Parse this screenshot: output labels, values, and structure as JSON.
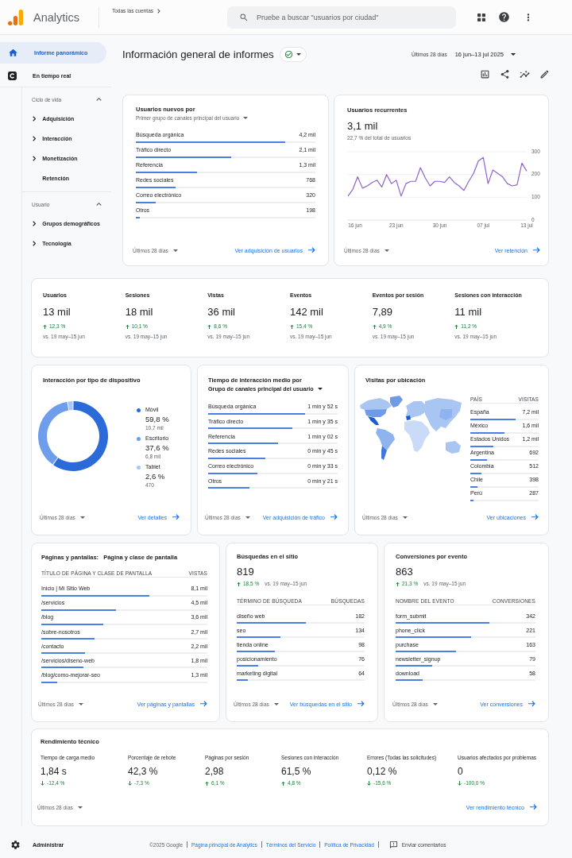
{
  "header": {
    "product": "Analytics",
    "breadcrumb": "Todas las cuentas",
    "search": {
      "placeholder": "Pruebe a buscar \"usuarios por ciudad\""
    }
  },
  "nav": {
    "items": [
      {
        "label": "Informe panorámico",
        "selected": true
      },
      {
        "label": "En tiempo real",
        "selected": false
      }
    ],
    "sections": [
      {
        "title": "Ciclo de vida",
        "expanded": true,
        "items": [
          {
            "label": "Adquisición",
            "kind": "group"
          },
          {
            "label": "Interacción",
            "kind": "group"
          },
          {
            "label": "Monetización",
            "kind": "group"
          },
          {
            "label": "Retención",
            "kind": "page"
          }
        ]
      },
      {
        "title": "Usuario",
        "expanded": true,
        "items": [
          {
            "label": "Grupos demográficos",
            "kind": "group"
          },
          {
            "label": "Tecnología",
            "kind": "group"
          }
        ]
      }
    ]
  },
  "report_header": {
    "title": "Información general de informes",
    "date_label": "Últimos 28 días",
    "date_range": "16 jun–13 jul 2025"
  },
  "new_users": {
    "title": "Usuarios nuevos por",
    "dimension": "Primer grupo de canales principal del usuario",
    "rows": [
      {
        "label": "Búsqueda orgánica",
        "value": "4,2 mil",
        "level": 0.83
      },
      {
        "label": "Tráfico directo",
        "value": "2,1 mil",
        "level": 0.53
      },
      {
        "label": "Referencia",
        "value": "1,3 mil",
        "level": 0.34
      },
      {
        "label": "Redes sociales",
        "value": "768",
        "level": 0.22
      },
      {
        "label": "Correo electrónico",
        "value": "320",
        "level": 0.11
      },
      {
        "label": "Otros",
        "value": "198",
        "level": 0.02
      }
    ],
    "period": "Últimos 28 días",
    "link": "Ver adquisición de usuarios"
  },
  "returning_users": {
    "title": "Usuarios recurrentes",
    "value": "3,1 mil",
    "note": "22,7 % del total de usuarios",
    "chart_data": {
      "type": "line",
      "categories": [
        null,
        "16 jun",
        null,
        null,
        null,
        null,
        null,
        null,
        null,
        null,
        "23 jun",
        null,
        null,
        null,
        null,
        null,
        null,
        null,
        null,
        "30 jun",
        null,
        null,
        null,
        null,
        null,
        null,
        null,
        null,
        "07 jul",
        null,
        null,
        null,
        null,
        null,
        null,
        null,
        null,
        "13 jul"
      ],
      "series": [
        {
          "color": "#8f63c9",
          "values": [
            105,
            135,
            190,
            140,
            150,
            165,
            175,
            145,
            200,
            160,
            175,
            105,
            160,
            170,
            170,
            230,
            185,
            150,
            170,
            170,
            165,
            190,
            165,
            150,
            130,
            170,
            205,
            260,
            275,
            160,
            220,
            205,
            190,
            160,
            150,
            155,
            250,
            215
          ]
        }
      ],
      "ylim": [
        0,
        300
      ],
      "yticks": [
        0,
        100,
        200,
        300
      ]
    },
    "period": "Últimos 28 días",
    "link": "Ver retención"
  },
  "summary": [
    {
      "label": "Usuarios",
      "value": "13 mil",
      "rising": true,
      "change": "12,3 %",
      "comparison": "vs. 19 may–15 jun"
    },
    {
      "label": "Sesiones",
      "value": "18 mil",
      "rising": true,
      "change": "10,1 %",
      "comparison": "vs. 19 may–15 jun"
    },
    {
      "label": "Vistas",
      "value": "36 mil",
      "rising": true,
      "change": "8,6 %",
      "comparison": "vs. 19 may–15 jun"
    },
    {
      "label": "Eventos",
      "value": "142 mil",
      "rising": true,
      "change": "15,4 %",
      "comparison": "vs. 19 may–15 jun"
    },
    {
      "label": "Eventos por sesión",
      "value": "7,89",
      "rising": true,
      "change": "4,9 %",
      "comparison": "vs. 19 may–15 jun"
    },
    {
      "label": "Sesiones con interacción",
      "value": "11 mil",
      "rising": true,
      "change": "11,2 %",
      "comparison": "vs. 19 may–15 jun"
    }
  ],
  "devices": {
    "title": "Interacción por tipo de dispositivo",
    "chart_data": {
      "type": "donut",
      "values": [
        59.8,
        37.6,
        2.6
      ]
    },
    "legend": [
      {
        "label": "Móvil",
        "share": "59,8 %",
        "count": "10,7 mil",
        "color": "#2b6bd9"
      },
      {
        "label": "Escritorio",
        "share": "37,6 %",
        "count": "6,8 mil",
        "color": "#6d9deb"
      },
      {
        "label": "Tablet",
        "share": "2,6 %",
        "count": "470",
        "color": "#a9c6f4"
      }
    ],
    "period": "Últimos 28 días",
    "link": "Ver detalles"
  },
  "engagement_time": {
    "title": "Tiempo de interacción medio por",
    "dimension": "Grupo de canales principal del usuario",
    "rows": [
      {
        "label": "Búsqueda orgánica",
        "value": "1 min y 52 s",
        "level": 0.75
      },
      {
        "label": "Tráfico directo",
        "value": "1 min y 35 s",
        "level": 0.65
      },
      {
        "label": "Referencia",
        "value": "1 min y 02 s",
        "level": 0.54
      },
      {
        "label": "Redes sociales",
        "value": "0 min y 45 s",
        "level": 0.44
      },
      {
        "label": "Correo electrónico",
        "value": "0 min y 33 s",
        "level": 0.38
      },
      {
        "label": "Otros",
        "value": "0 min y 21 s",
        "level": 0.32
      }
    ],
    "period": "Últimos 28 días",
    "link": "Ver adquisición de tráfico"
  },
  "locations": {
    "title": "Visitas por ubicación",
    "columns": [
      "PAÍS",
      "VISITAS"
    ],
    "rows": [
      {
        "label": "España",
        "value": "7,2 mil",
        "level": 0.66
      },
      {
        "label": "México",
        "value": "1,6 mil",
        "level": 0.5
      },
      {
        "label": "Estados Unidos",
        "value": "1,2 mil",
        "level": 0.34
      },
      {
        "label": "Argentina",
        "value": "692",
        "level": 0.24
      },
      {
        "label": "Colombia",
        "value": "512",
        "level": 0.16
      },
      {
        "label": "Chile",
        "value": "398",
        "level": 0.1
      },
      {
        "label": "Perú",
        "value": "287",
        "level": 0.05
      }
    ],
    "period": "Últimos 28 días",
    "link": "Ver ubicaciones"
  },
  "pages": {
    "title": "Páginas y pantallas:",
    "dimension": "Página y clase de pantalla",
    "columns": [
      "TÍTULO DE PÁGINA Y CLASE DE PANTALLA",
      "VISTAS"
    ],
    "rows": [
      {
        "label": "Inicio | Mi Sitio Web",
        "value": "8,1 mil",
        "level": 0.65
      },
      {
        "label": "/servicios",
        "value": "4,5 mil",
        "level": 0.45
      },
      {
        "label": "/blog",
        "value": "3,6 mil",
        "level": 0.375
      },
      {
        "label": "/sobre-nosotros",
        "value": "2,7 mil",
        "level": 0.32
      },
      {
        "label": "/contacto",
        "value": "2,2 mil",
        "level": 0.265
      },
      {
        "label": "/servicios/diseno-web",
        "value": "1,8 mil",
        "level": 0.255
      },
      {
        "label": "/blog/como-mejorar-seo",
        "value": "1,3 mil",
        "level": 0.095
      }
    ],
    "period": "Últimos 28 días",
    "link": "Ver páginas y pantallas"
  },
  "site_search": {
    "title": "Búsquedas en el sitio",
    "value": "819",
    "rising": true,
    "change": "18,5 %",
    "comparison": "vs. 19 may–15 jun",
    "columns": [
      "TÉRMINO DE BÚSQUEDA",
      "BÚSQUEDAS"
    ],
    "rows": [
      {
        "label": "diseño web",
        "value": "182",
        "level": 0.54
      },
      {
        "label": "seo",
        "value": "134",
        "level": 0.34
      },
      {
        "label": "tienda online",
        "value": "98",
        "level": 0.3
      },
      {
        "label": "posicionamiento",
        "value": "76",
        "level": 0.17
      },
      {
        "label": "marketing digital",
        "value": "64",
        "level": 0.09
      }
    ],
    "period": "Últimos 28 días",
    "link": "Ver búsquedas en el sitio"
  },
  "conversions": {
    "title": "Conversiones por evento",
    "value": "863",
    "rising": true,
    "change": "21,3 %",
    "comparison": "vs. 19 may–15 jun",
    "columns": [
      "NOMBRE DEL EVENTO",
      "CONVERSIONES"
    ],
    "rows": [
      {
        "label": "form_submit",
        "value": "342",
        "level": 0.67
      },
      {
        "label": "phone_click",
        "value": "221",
        "level": 0.54
      },
      {
        "label": "purchase",
        "value": "163",
        "level": 0.43
      },
      {
        "label": "newsletter_signup",
        "value": "79",
        "level": 0.26
      },
      {
        "label": "download",
        "value": "58",
        "level": 0.195
      }
    ],
    "period": "Últimos 28 días",
    "link": "Ver conversiones"
  },
  "technical": {
    "title": "Rendimiento técnico",
    "metrics": [
      {
        "label": "Tiempo de carga medio",
        "value": "1,84 s",
        "rising": false,
        "change": "-12,4 %"
      },
      {
        "label": "Porcentaje de rebote",
        "value": "42,3 %",
        "rising": false,
        "change": "-7,3 %"
      },
      {
        "label": "Páginas por sesión",
        "value": "2,98",
        "rising": true,
        "change": "6,1 %"
      },
      {
        "label": "Sesiones con interacción",
        "value": "61,5 %",
        "rising": true,
        "change": "4,8 %"
      },
      {
        "label": "Errores (Todas las solicitudes)",
        "value": "0,12 %",
        "rising": false,
        "change": "-15,6 %"
      },
      {
        "label": "Usuarios afectados por problemas",
        "value": "0",
        "rising": false,
        "change": "-100,0 %"
      }
    ],
    "period": "Últimos 28 días",
    "link": "Ver rendimiento técnico"
  },
  "footer": {
    "admin": "Administrar",
    "copyright": "©2025 Google",
    "links": [
      "Página principal de Analytics",
      "Términos del Servicio",
      "Política de Privacidad"
    ],
    "feedback": "Enviar comentarios"
  }
}
